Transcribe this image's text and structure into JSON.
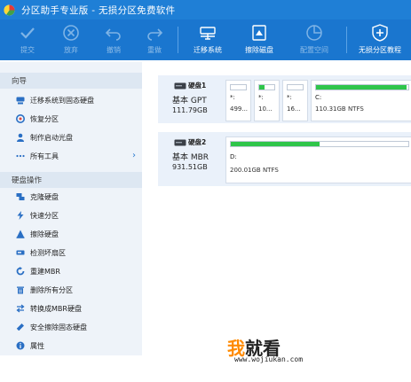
{
  "window": {
    "title": "分区助手专业版 - 无损分区免费软件"
  },
  "toolbar": {
    "buttons": [
      {
        "label": "提交",
        "icon": "check-icon",
        "enabled": false
      },
      {
        "label": "放弃",
        "icon": "cancel-circle-icon",
        "enabled": false
      },
      {
        "label": "撤销",
        "icon": "undo-icon",
        "enabled": false
      },
      {
        "label": "重做",
        "icon": "redo-icon",
        "enabled": false
      },
      {
        "label": "迁移系统",
        "icon": "migrate-system-icon",
        "enabled": true
      },
      {
        "label": "擦除磁盘",
        "icon": "wipe-disk-icon",
        "enabled": true
      },
      {
        "label": "配置空间",
        "icon": "allocate-space-icon",
        "enabled": false
      },
      {
        "label": "无损分区教程",
        "icon": "tutorial-plus-icon",
        "enabled": true
      }
    ]
  },
  "sidebar": {
    "wizard_header": "向导",
    "wizard_items": [
      {
        "label": "迁移系统到固态硬盘",
        "icon": "disk-icon"
      },
      {
        "label": "恢复分区",
        "icon": "restore-icon"
      },
      {
        "label": "制作启动光盘",
        "icon": "user-icon"
      },
      {
        "label": "所有工具",
        "icon": "more-dots-icon",
        "arrow": "›"
      }
    ],
    "ops_header": "硬盘操作",
    "ops_items": [
      {
        "label": "克隆硬盘",
        "icon": "clone-icon"
      },
      {
        "label": "快速分区",
        "icon": "lightning-icon"
      },
      {
        "label": "擦除硬盘",
        "icon": "eraser-icon"
      },
      {
        "label": "检测坏扇区",
        "icon": "drive-scan-icon"
      },
      {
        "label": "重建MBR",
        "icon": "rebuild-icon"
      },
      {
        "label": "删除所有分区",
        "icon": "trash-icon"
      },
      {
        "label": "转换成MBR硬盘",
        "icon": "convert-icon"
      },
      {
        "label": "安全擦除固态硬盘",
        "icon": "secure-erase-icon"
      },
      {
        "label": "属性",
        "icon": "info-icon"
      }
    ]
  },
  "disks": [
    {
      "name": "硬盘1",
      "type": "基本 GPT",
      "size": "111.79GB",
      "partitions": [
        {
          "label": "*:",
          "size": "499...",
          "used": 0.0
        },
        {
          "label": "*:",
          "size": "10...",
          "used": 0.35
        },
        {
          "label": "*:",
          "size": "16...",
          "used": 0.0
        },
        {
          "label": "C:",
          "size": "110.31GB NTFS",
          "used": 0.98
        }
      ]
    },
    {
      "name": "硬盘2",
      "type": "基本 MBR",
      "size": "931.51GB",
      "partitions": [
        {
          "label": "D:",
          "size": "200.01GB NTFS",
          "used": 0.5
        }
      ]
    }
  ],
  "watermark": {
    "text_a": "我",
    "text_b": "就看",
    "url": "www.wojiukan.com"
  },
  "colors": {
    "titlebar": "#1f7fd6",
    "toolbar": "#1a76cf",
    "usage_fill": "#2fc54a",
    "sidebar_bg": "#eef3f9"
  }
}
